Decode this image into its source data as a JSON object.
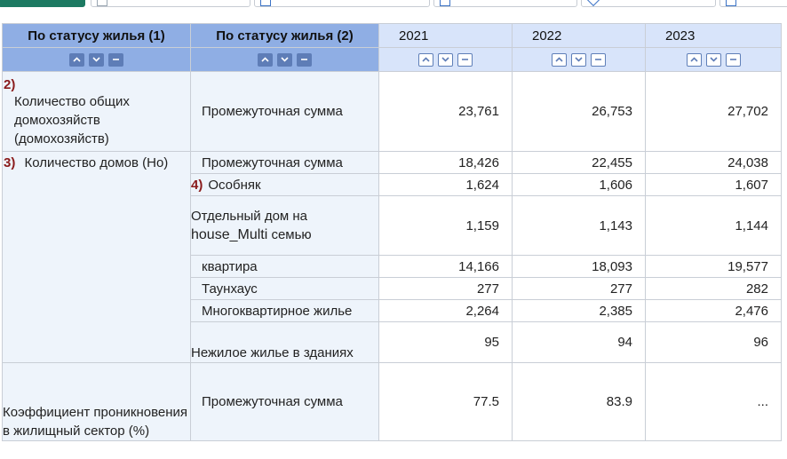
{
  "toolbar": [
    {
      "label": "",
      "style": "green",
      "icon": "none"
    },
    {
      "label": "",
      "style": "plain",
      "icon": "doc-icon"
    },
    {
      "label": "",
      "style": "plain",
      "icon": "doc-icon"
    },
    {
      "label": "",
      "style": "plain",
      "icon": "doc-icon"
    },
    {
      "label": "",
      "style": "plain",
      "icon": "diamond-icon"
    },
    {
      "label": "",
      "style": "plain",
      "icon": "close-icon"
    }
  ],
  "table": {
    "dim_headers": [
      "По статусу жилья (1)",
      "По статусу жилья (2)"
    ],
    "years": [
      "2021",
      "2022",
      "2023"
    ],
    "group1": {
      "marker": "2)",
      "label": "Количество общих домохозяйств (домохозяйств)",
      "sub": "Промежуточная сумма",
      "values": [
        "23,761",
        "26,753",
        "27,702"
      ]
    },
    "group2": {
      "marker": "3)",
      "label": "Количество домов (Но)",
      "rows": [
        {
          "marker": "",
          "label": "Промежуточная сумма",
          "values": [
            "18,426",
            "22,455",
            "24,038"
          ]
        },
        {
          "marker": "4)",
          "label": "Особняк",
          "values": [
            "1,624",
            "1,606",
            "1,607"
          ]
        },
        {
          "marker": "",
          "label_a": "Отдельный дом на",
          "label_b": "house_Multi",
          "label_c": " семью",
          "values": [
            "1,159",
            "1,143",
            "1,144"
          ]
        },
        {
          "marker": "",
          "label": "квартира",
          "values": [
            "14,166",
            "18,093",
            "19,577"
          ]
        },
        {
          "marker": "",
          "label": "Таунхаус",
          "values": [
            "277",
            "277",
            "282"
          ]
        },
        {
          "marker": "",
          "label": "Многоквартирное жилье",
          "values": [
            "2,264",
            "2,385",
            "2,476"
          ]
        },
        {
          "marker": "",
          "label": "Нежилое жилье в зданиях",
          "values": [
            "95",
            "94",
            "96"
          ]
        }
      ]
    },
    "group3": {
      "label": "Коэффициент проникновения в жилищный сектор (%)",
      "sub": "Промежуточная сумма",
      "values": [
        "77.5",
        "83.9",
        "..."
      ]
    }
  },
  "colors": {
    "header_dim": "#8faee4",
    "header_year": "#d8e4fa",
    "row_label_bg": "#eef4fb",
    "marker": "#8a1b1b"
  }
}
